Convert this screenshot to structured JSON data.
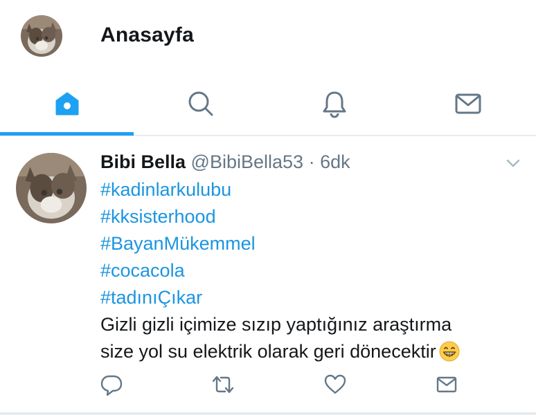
{
  "header": {
    "title": "Anasayfa"
  },
  "tabs": [
    {
      "name": "home",
      "icon": "home-icon",
      "active": true
    },
    {
      "name": "search",
      "icon": "search-icon",
      "active": false
    },
    {
      "name": "notifications",
      "icon": "bell-icon",
      "active": false
    },
    {
      "name": "messages",
      "icon": "mail-icon",
      "active": false
    }
  ],
  "tweet": {
    "display_name": "Bibi Bella",
    "handle": "@BibiBella53",
    "separator": "·",
    "time": "6dk",
    "hashtags": [
      "#kadinlarkulubu",
      "#kksisterhood",
      "#BayanMükemmel",
      "#cocacola",
      "#tadınıÇıkar"
    ],
    "text_lines": [
      "Gizli gizli içimize sızıp yaptığınız araştırma",
      "size yol su elektrik olarak geri dönecektir"
    ],
    "emoji": "grinning-face-emoji"
  },
  "colors": {
    "accent": "#1da1f2",
    "link": "#1b95e0",
    "muted": "#657786",
    "text": "#14171a",
    "divider": "#e6ecf0"
  }
}
